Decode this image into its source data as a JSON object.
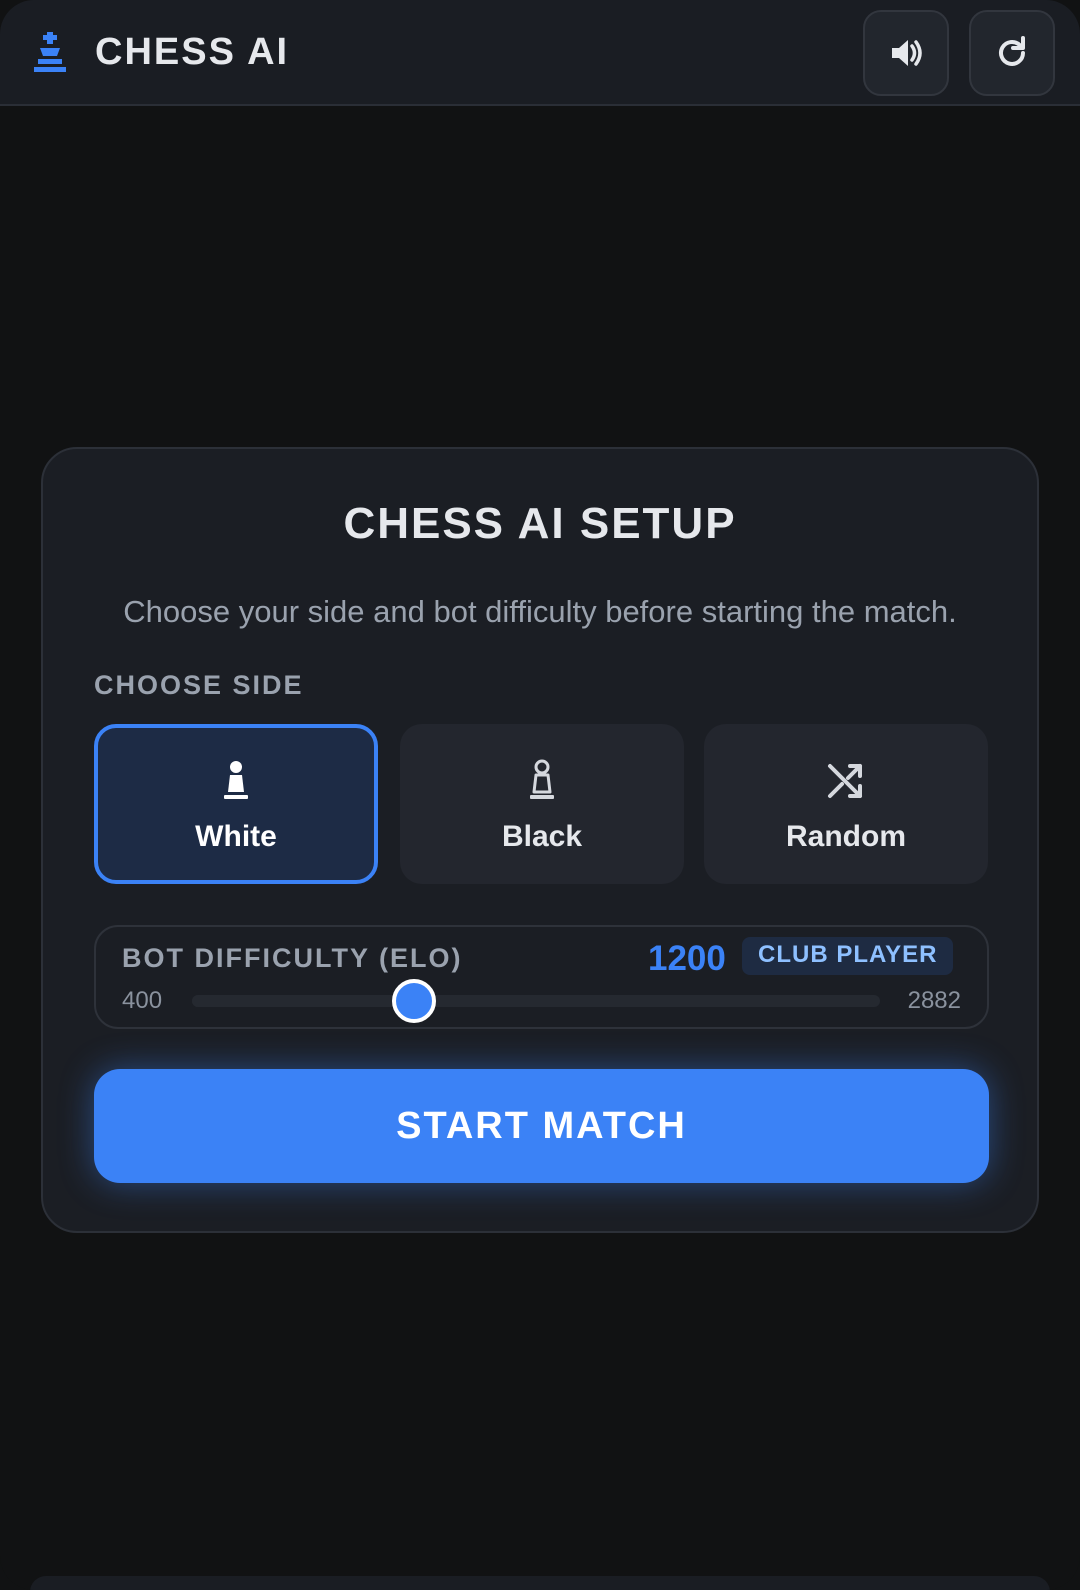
{
  "header": {
    "title": "CHESS AI",
    "brand_icon": "chess-king-icon",
    "sound_icon": "speaker-icon",
    "reset_icon": "refresh-icon"
  },
  "setup": {
    "title": "CHESS AI SETUP",
    "subtitle": "Choose your side and bot difficulty before starting the match.",
    "side_label": "CHOOSE SIDE",
    "sides": [
      {
        "label": "White",
        "icon": "white-pawn-icon",
        "selected": true
      },
      {
        "label": "Black",
        "icon": "black-pawn-icon",
        "selected": false
      },
      {
        "label": "Random",
        "icon": "shuffle-icon",
        "selected": false
      }
    ],
    "difficulty": {
      "label": "BOT DIFFICULTY (ELO)",
      "value": "1200",
      "level_badge": "CLUB PLAYER",
      "min": "400",
      "max": "2882",
      "current": 1200,
      "range_min": 400,
      "range_max": 2882
    },
    "start_label": "START MATCH"
  },
  "colors": {
    "accent": "#3b82f6",
    "background": "#111213",
    "card": "#1b1e24",
    "text": "#e6e8ec",
    "muted": "#9aa2ae"
  }
}
